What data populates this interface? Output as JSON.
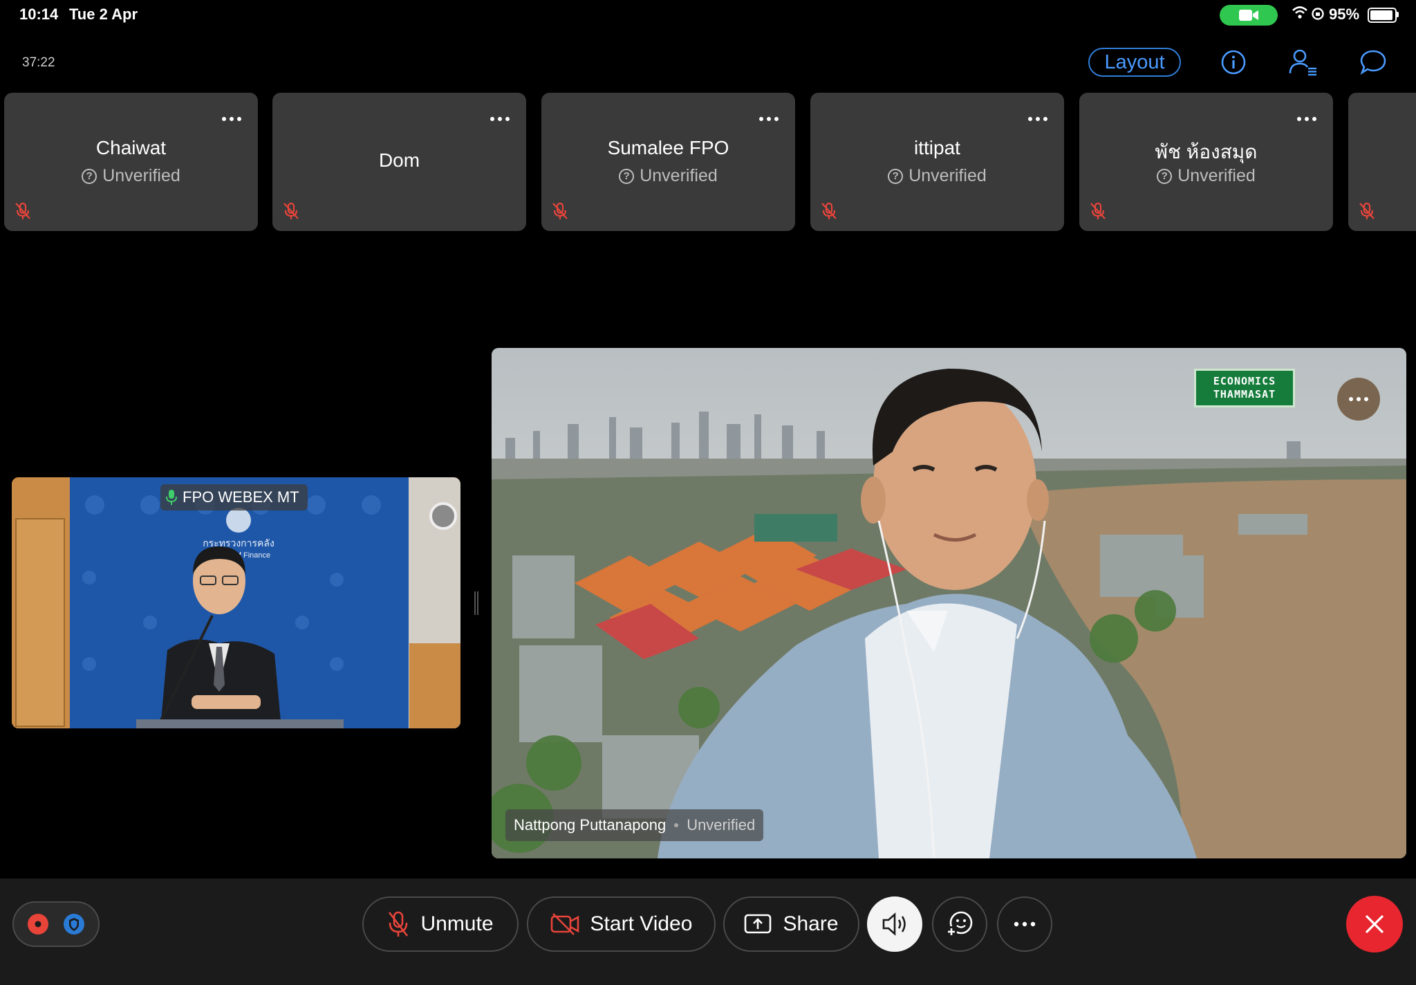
{
  "status_bar": {
    "time": "10:14",
    "date": "Tue 2 Apr",
    "battery_pct": "95%",
    "battery_level": 0.95
  },
  "header": {
    "timer": "37:22",
    "layout_label": "Layout"
  },
  "participants": [
    {
      "name": "Chaiwat",
      "status": "Unverified"
    },
    {
      "name": "Dom",
      "status": ""
    },
    {
      "name": "Sumalee FPO",
      "status": "Unverified"
    },
    {
      "name": "ittipat",
      "status": "Unverified"
    },
    {
      "name": "พัช ห้องสมุด",
      "status": "Unverified"
    }
  ],
  "small_video": {
    "label": "FPO WEBEX MT",
    "backdrop_text": "กระทรวงการคลัง",
    "backdrop_sub": "Ministry of Finance"
  },
  "main_video": {
    "name": "Nattpong Puttanapong",
    "status": "Unverified",
    "logo_line1": "ECONOMICS",
    "logo_line2": "THAMMASAT"
  },
  "controls": {
    "unmute": "Unmute",
    "start_video": "Start Video",
    "share": "Share"
  },
  "colors": {
    "accent": "#4a9bff",
    "mute_red": "#e8443a",
    "end_red": "#e8262f",
    "camera_green": "#30c750"
  }
}
